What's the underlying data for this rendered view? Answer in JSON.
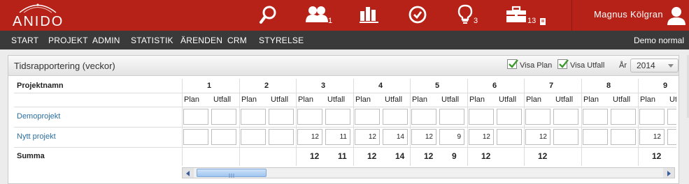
{
  "app": {
    "logo_text": "ANIDO",
    "user": "Magnus Kölgran",
    "mode": "Demo normal"
  },
  "topbar": {
    "people_count": "1",
    "ideas_count": "3",
    "briefcase_count": "13"
  },
  "nav": [
    "START",
    "PROJEKT",
    "ADMIN",
    "STATISTIK",
    "ÄRENDEN",
    "CRM",
    "STYRELSE"
  ],
  "panel": {
    "title": "Tidsrapportering (veckor)",
    "visa_plan": "Visa Plan",
    "visa_utfall": "Visa Utfall",
    "year_label": "År",
    "year": "2014"
  },
  "table": {
    "project_header": "Projektnamn",
    "plan_label": "Plan",
    "utfall_label": "Utfall",
    "weeks": [
      "1",
      "2",
      "3",
      "4",
      "5",
      "6",
      "7",
      "8",
      "9"
    ],
    "rows": [
      {
        "name": "Demoprojekt",
        "cells": [
          [
            "",
            ""
          ],
          [
            "",
            ""
          ],
          [
            "",
            ""
          ],
          [
            "",
            ""
          ],
          [
            "",
            ""
          ],
          [
            "",
            ""
          ],
          [
            "",
            ""
          ],
          [
            "",
            ""
          ],
          [
            "",
            ""
          ]
        ]
      },
      {
        "name": "Nytt projekt",
        "cells": [
          [
            "",
            ""
          ],
          [
            "",
            ""
          ],
          [
            "12",
            "11"
          ],
          [
            "12",
            "14"
          ],
          [
            "12",
            "9"
          ],
          [
            "12",
            ""
          ],
          [
            "12",
            ""
          ],
          [
            "",
            ""
          ],
          [
            "12",
            ""
          ]
        ]
      }
    ],
    "summa_label": "Summa",
    "summa": [
      [
        "",
        ""
      ],
      [
        "",
        ""
      ],
      [
        "12",
        "11"
      ],
      [
        "12",
        "14"
      ],
      [
        "12",
        "9"
      ],
      [
        "12",
        ""
      ],
      [
        "12",
        ""
      ],
      [
        "",
        ""
      ],
      [
        "12",
        ""
      ]
    ]
  },
  "colors": {
    "brand": "#b72218",
    "nav": "#3a3a3a",
    "link": "#2a6ea0"
  }
}
